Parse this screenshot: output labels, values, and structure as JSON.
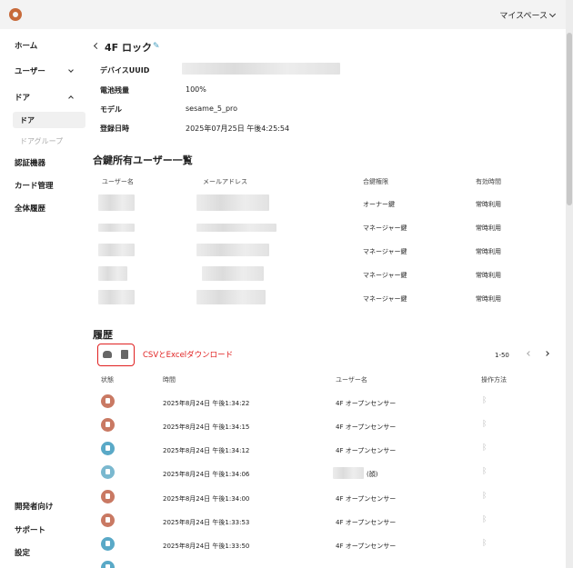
{
  "header": {
    "space_label": "マイスペース"
  },
  "sidebar": {
    "home": "ホーム",
    "users": "ユーザー",
    "doors": "ドア",
    "door_sub": "ドア",
    "door_group": "ドアグループ",
    "auth_devices": "認証機器",
    "cards": "カード管理",
    "history": "全体履歴",
    "developer": "開発者向け",
    "support": "サポート",
    "settings": "設定"
  },
  "device": {
    "title": "4F ロック",
    "uuid_label": "デバイスUUID",
    "battery_label": "電池残量",
    "battery": "100%",
    "model_label": "モデル",
    "model": "sesame_5_pro",
    "registered_label": "登録日時",
    "registered": "2025年07月25日 午後4:25:54"
  },
  "keys": {
    "title": "合鍵所有ユーザー一覧",
    "headers": [
      "ユーザー名",
      "メールアドレス",
      "合鍵権限",
      "有効時間"
    ],
    "rows": [
      {
        "role": "オーナー鍵",
        "time": "常時利用"
      },
      {
        "role": "マネージャー鍵",
        "time": "常時利用"
      },
      {
        "role": "マネージャー鍵",
        "time": "常時利用"
      },
      {
        "role": "マネージャー鍵",
        "time": "常時利用"
      },
      {
        "role": "マネージャー鍵",
        "time": "常時利用"
      }
    ]
  },
  "history": {
    "title": "履歴",
    "annotation": "CSVとExcelダウンロード",
    "page_range": "1-50",
    "headers": [
      "状態",
      "時間",
      "ユーザー名",
      "操作方法"
    ],
    "rows": [
      {
        "time": "2025年8月24日 午後1:34:22",
        "user": "4F オープンセンサー",
        "status": "lock"
      },
      {
        "time": "2025年8月24日 午後1:34:15",
        "user": "4F オープンセンサー",
        "status": "open"
      },
      {
        "time": "2025年8月24日 午後1:34:12",
        "user": "4F オープンセンサー",
        "status": "open"
      },
      {
        "time": "2025年8月24日 午後1:34:06",
        "user": "(顔)",
        "status": "unlock"
      },
      {
        "time": "2025年8月24日 午後1:34:00",
        "user": "4F オープンセンサー",
        "status": "lock"
      },
      {
        "time": "2025年8月24日 午後1:33:53",
        "user": "4F オープンセンサー",
        "status": "open"
      },
      {
        "time": "2025年8月24日 午後1:33:50",
        "user": "4F オープンセンサー",
        "status": "open"
      }
    ]
  },
  "colors": {
    "lock": "#c97963",
    "open": "#5aa9c7",
    "unlock": "#7ab8cf",
    "annotation": "#e02020"
  }
}
